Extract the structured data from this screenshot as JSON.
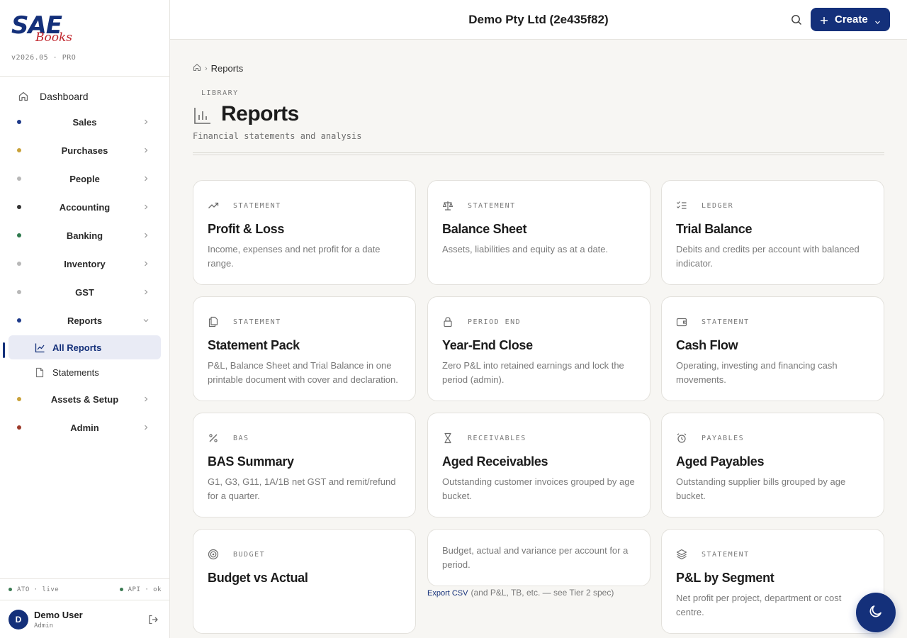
{
  "brand": {
    "logo_main": "SAE",
    "logo_script": "Books",
    "version": "v2026.05 · PRO",
    "colors": {
      "primary": "#14307a",
      "logo_red": "#c0242b"
    }
  },
  "sidebar": {
    "dashboard": {
      "label": "Dashboard",
      "icon": "home-icon"
    },
    "groups": [
      {
        "label": "Sales",
        "dot_color": "#1e3a8a"
      },
      {
        "label": "Purchases",
        "dot_color": "#c9a23a"
      },
      {
        "label": "People",
        "dot_color": "#b8b8b8"
      },
      {
        "label": "Accounting",
        "dot_color": "#333333"
      },
      {
        "label": "Banking",
        "dot_color": "#2f7a4e"
      },
      {
        "label": "Inventory",
        "dot_color": "#b8b8b8"
      },
      {
        "label": "GST",
        "dot_color": "#b8b8b8"
      },
      {
        "label": "Reports",
        "dot_color": "#1e3a8a"
      },
      {
        "label": "Assets & Setup",
        "dot_color": "#c9a23a"
      },
      {
        "label": "Admin",
        "dot_color": "#9c3a2a"
      }
    ],
    "reports_sub": [
      {
        "label": "All Reports",
        "icon": "chart-line-icon",
        "active": true
      },
      {
        "label": "Statements",
        "icon": "document-icon",
        "active": false
      }
    ],
    "status": {
      "ato": "ATO · live",
      "api": "API · ok"
    },
    "user": {
      "initial": "D",
      "name": "Demo User",
      "role": "Admin"
    }
  },
  "topbar": {
    "company": "Demo Pty Ltd (2e435f82)",
    "create_label": "Create"
  },
  "page": {
    "breadcrumb": "Reports",
    "eyebrow": "LIBRARY",
    "title": "Reports",
    "subtitle": "Financial statements and analysis"
  },
  "cards": [
    {
      "eyebrow": "STATEMENT",
      "title": "Profit & Loss",
      "desc": "Income, expenses and net profit for a date range.",
      "icon": "trend-up-icon"
    },
    {
      "eyebrow": "STATEMENT",
      "title": "Balance Sheet",
      "desc": "Assets, liabilities and equity as at a date.",
      "icon": "scale-icon"
    },
    {
      "eyebrow": "LEDGER",
      "title": "Trial Balance",
      "desc": "Debits and credits per account with balanced indicator.",
      "icon": "checklist-icon"
    },
    {
      "eyebrow": "STATEMENT",
      "title": "Statement Pack",
      "desc": "P&L, Balance Sheet and Trial Balance in one printable document with cover and declaration.",
      "icon": "files-icon"
    },
    {
      "eyebrow": "PERIOD END",
      "title": "Year-End Close",
      "desc": "Zero P&L into retained earnings and lock the period (admin).",
      "icon": "lock-icon"
    },
    {
      "eyebrow": "STATEMENT",
      "title": "Cash Flow",
      "desc": "Operating, investing and financing cash movements.",
      "icon": "wallet-icon"
    },
    {
      "eyebrow": "BAS",
      "title": "BAS Summary",
      "desc": "G1, G3, G11, 1A/1B net GST and remit/refund for a quarter.",
      "icon": "percent-icon"
    },
    {
      "eyebrow": "RECEIVABLES",
      "title": "Aged Receivables",
      "desc": "Outstanding customer invoices grouped by age bucket.",
      "icon": "hourglass-icon"
    },
    {
      "eyebrow": "PAYABLES",
      "title": "Aged Payables",
      "desc": "Outstanding supplier bills grouped by age bucket.",
      "icon": "alarm-clock-icon"
    },
    {
      "eyebrow": "BUDGET",
      "title": "Budget vs Actual",
      "desc": "",
      "icon": "target-icon"
    },
    {
      "eyebrow": "",
      "title": "",
      "desc": "Budget, actual and variance per account for a period.",
      "icon": ""
    },
    {
      "eyebrow": "STATEMENT",
      "title": "P&L by Segment",
      "desc": "Net profit per project, department or cost centre.",
      "icon": "layers-icon"
    }
  ],
  "export_note": {
    "link": "Export CSV",
    "text": "(and P&L, TB, etc. — see Tier 2 spec)"
  }
}
